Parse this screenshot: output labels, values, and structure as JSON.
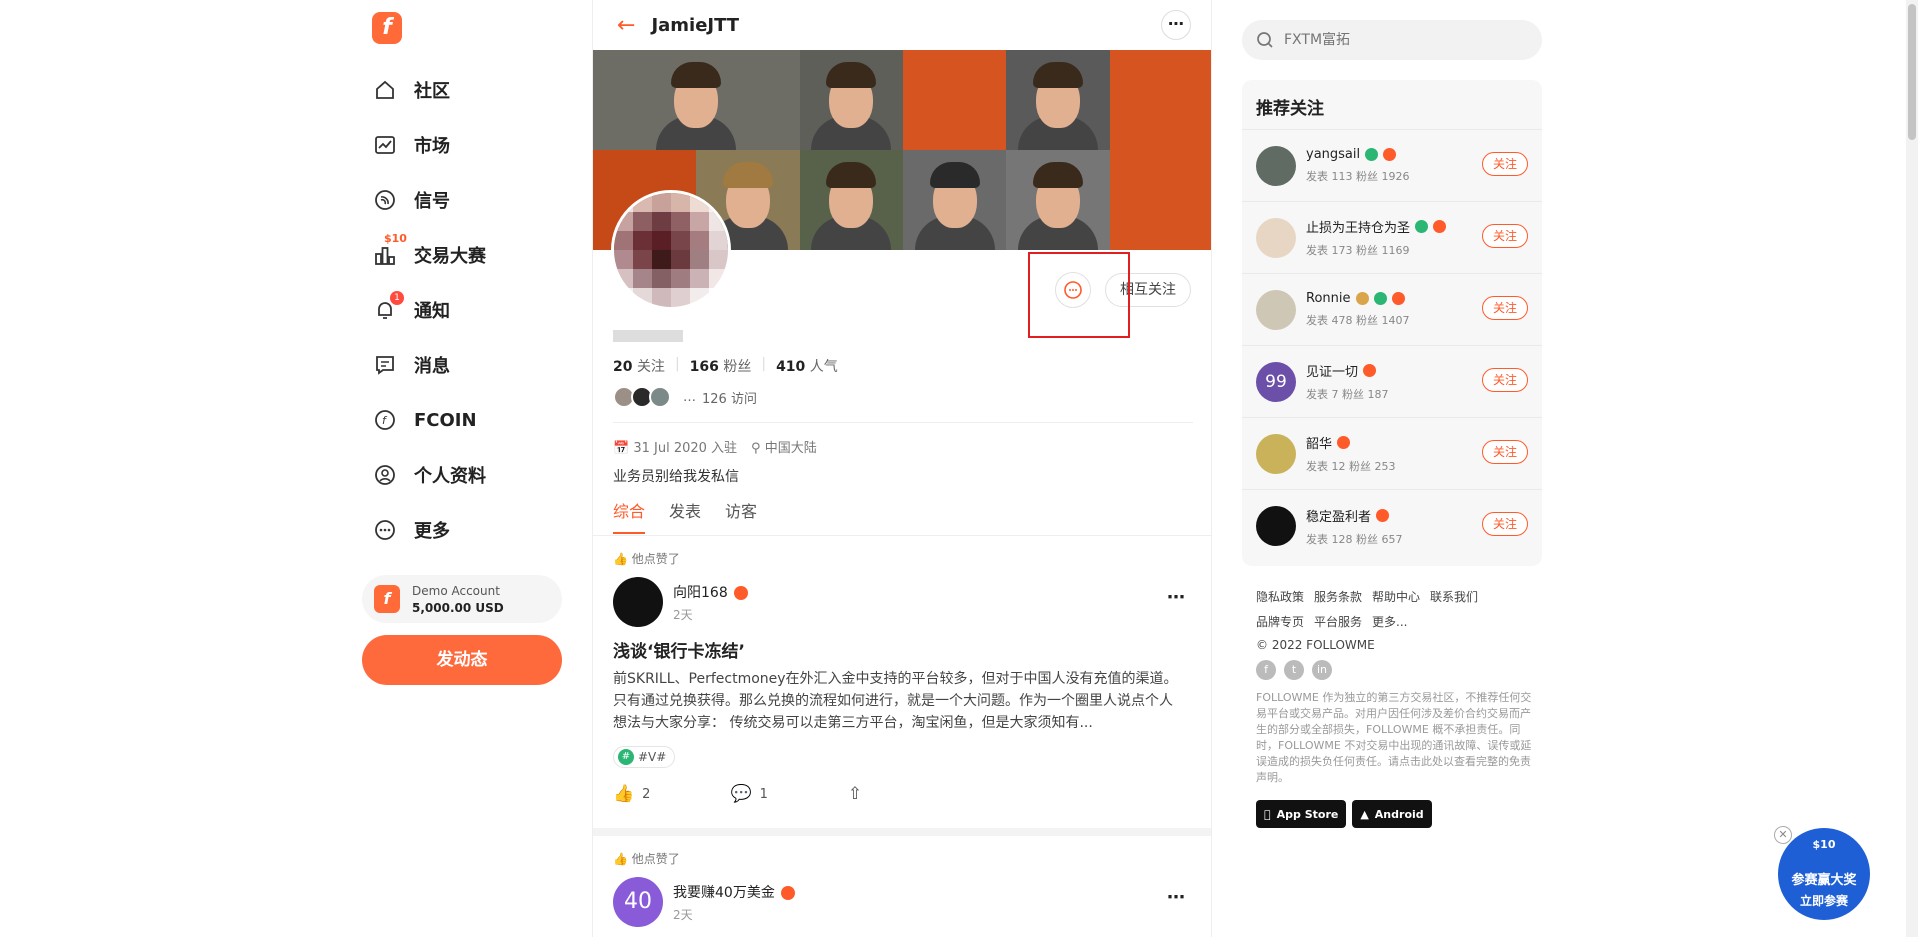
{
  "nav": {
    "items": [
      {
        "label": "社区",
        "icon": "home-icon"
      },
      {
        "label": "市场",
        "icon": "chart-icon"
      },
      {
        "label": "信号",
        "icon": "signal-icon"
      },
      {
        "label": "交易大赛",
        "icon": "contest-icon",
        "badge": "$10"
      },
      {
        "label": "通知",
        "icon": "bell-icon",
        "badge": "1"
      },
      {
        "label": "消息",
        "icon": "message-icon"
      },
      {
        "label": "FCOIN",
        "icon": "fcoin-icon"
      },
      {
        "label": "个人资料",
        "icon": "user-icon"
      },
      {
        "label": "更多",
        "icon": "more-icon"
      }
    ],
    "demo": {
      "title": "Demo Account",
      "balance": "5,000.00",
      "currency": "USD"
    },
    "post_button": "发动态"
  },
  "profile": {
    "username": "JamieJTT",
    "mutual_label": "相互关注",
    "stats": {
      "following": "20",
      "following_label": "关注",
      "fans": "166",
      "fans_label": "粉丝",
      "popularity": "410",
      "popularity_label": "人气"
    },
    "visits": "126 访问",
    "joined": "31 Jul 2020 入驻",
    "location": "中国大陆",
    "bio": "业务员别给我发私信",
    "tabs": [
      "综合",
      "发表",
      "访客"
    ]
  },
  "posts": [
    {
      "liked_by": "他点赞了",
      "author": "向阳168",
      "time": "2天",
      "title": "浅谈‘银行卡冻结’",
      "body": "前SKRILL、Perfectmoney在外汇入金中支持的平台较多，但对于中国人没有充值的渠道。只有通过兑换获得。那么兑换的流程如何进行，就是一个大问题。作为一个圈里人说点个人想法与大家分享： 传统交易可以走第三方平台，淘宝闲鱼，但是大家须知有...",
      "tag": "#V#",
      "likes": "2",
      "comments": "1"
    },
    {
      "liked_by": "他点赞了",
      "author": "我要赚40万美金",
      "avatar_text": "40",
      "time": "2天"
    }
  ],
  "search": {
    "placeholder": "FXTM富拓"
  },
  "recommend": {
    "title": "推荐关注",
    "follow_label": "关注",
    "items": [
      {
        "name": "yangsail",
        "stats": "发表 113   粉丝 1926"
      },
      {
        "name": "止损为王持仓为圣",
        "stats": "发表 173   粉丝 1169"
      },
      {
        "name": "Ronnie",
        "stats": "发表 478   粉丝 1407"
      },
      {
        "name": "见证一切",
        "avatar_text": "99",
        "stats": "发表 7   粉丝 187"
      },
      {
        "name": "韶华",
        "stats": "发表 12   粉丝 253"
      },
      {
        "name": "稳定盈利者",
        "stats": "发表 128   粉丝 657"
      }
    ]
  },
  "footer": {
    "links_row1": [
      "隐私政策",
      "服务条款",
      "帮助中心",
      "联系我们"
    ],
    "links_row2": [
      "品牌专页",
      "平台服务",
      "更多..."
    ],
    "copyright": "© 2022 FOLLOWME",
    "disclaimer": "FOLLOWME 作为独立的第三方交易社区，不推荐任何交易平台或交易产品。对用户因任何涉及差价合约交易而产生的部分或全部损失，FOLLOWME 概不承担责任。同时，FOLLOWME 不对交易中出现的通讯故障、误传或延误造成的损失负任何责任。请点击此处以查看完整的免责声明。",
    "app_store": "App Store",
    "android": "Android"
  },
  "float_ad": {
    "top": "$10",
    "line1": "参赛赢大奖",
    "line2": "立即参赛"
  }
}
